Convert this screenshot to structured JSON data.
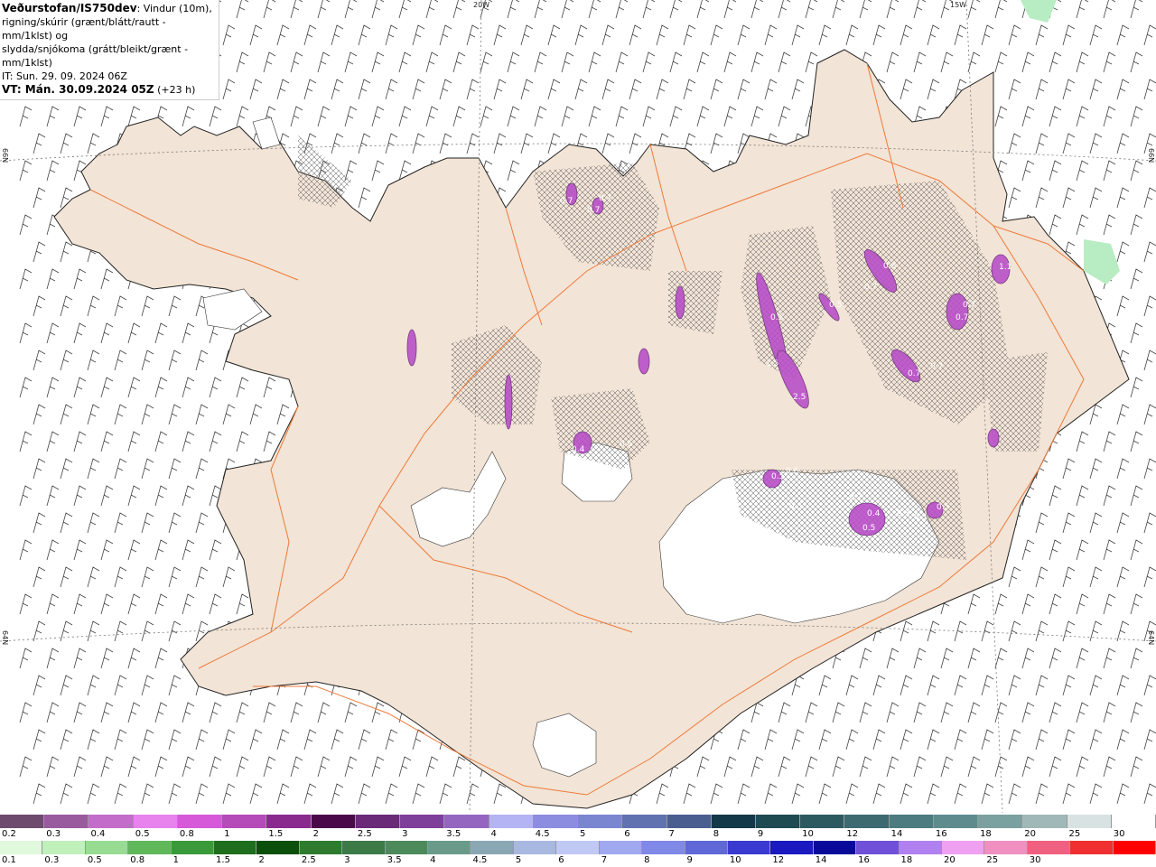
{
  "header": {
    "title": "Veðurstofan/IS750dev",
    "line1": ": Vindur (10m),",
    "line2": "rigning/skúrir (grænt/blátt/rautt - mm/1klst) og",
    "line3": "slydda/snjókoma (grátt/bleikt/grænt - mm/1klst)",
    "it_line": "IT: Sun. 29. 09. 2024 06Z",
    "vt_bold": "VT: Mán. 30.09.2024 05Z",
    "vt_rest": " (+23 h)"
  },
  "map_labels": {
    "lon_20w": "20W",
    "lon_15w": "15W",
    "lat_66_left": "66N",
    "lat_66_right": "66N",
    "lat_64_left": "64N",
    "lat_64_right": "64N"
  },
  "precip_values": [
    "0.7",
    "0.7",
    "0.7",
    "0.5",
    "0.4",
    "0.6",
    "1.5",
    "2.5",
    "0.5",
    "0.8",
    "0.7",
    "0.7",
    "0.7",
    "1.1",
    "0.7",
    "0.7",
    "0.5",
    "0.6",
    "0.7",
    "0.4",
    "0.5",
    "0.3",
    "0.3",
    "0.5",
    "0.5"
  ],
  "colors": {
    "land": "#f2e4d6",
    "ice": "#ffffff",
    "roads": "#ee7a3a",
    "coast": "#222222",
    "snow_purple": "#b84fc8",
    "rain_green": "#b8ecc2"
  },
  "scale_top": {
    "colors": [
      "#6e4a6e",
      "#9a5a9e",
      "#c36cc9",
      "#e882ec",
      "#d659d9",
      "#b44bb8",
      "#8a2a8e",
      "#4a0a4a",
      "#6a2a78",
      "#7e3f9a",
      "#9566c0",
      "#b4b4f4",
      "#8c8ce0",
      "#7a86d0",
      "#6073b0",
      "#4a5e90",
      "#133848",
      "#1e4a52",
      "#2d5a60",
      "#3c6a70",
      "#4c7c80",
      "#5e8c8e",
      "#7aa0a0",
      "#a0b8b8",
      "#d8e2e2",
      "#ffffff"
    ],
    "labels": [
      "0.2",
      "0.3",
      "0.4",
      "0.5",
      "0.8",
      "1",
      "1.5",
      "2",
      "2.5",
      "3",
      "3.5",
      "4",
      "4.5",
      "5",
      "6",
      "7",
      "8",
      "9",
      "10",
      "12",
      "14",
      "16",
      "18",
      "20",
      "25",
      "30"
    ]
  },
  "scale_bottom": {
    "colors": [
      "#e0f8dc",
      "#c0f0bc",
      "#98dc94",
      "#5fb85a",
      "#3a9a3a",
      "#1e6e1e",
      "#0a500a",
      "#2e7a2e",
      "#3c7a48",
      "#4c8a5c",
      "#6a9a8a",
      "#8aa8b4",
      "#a8b8e0",
      "#c0c8f4",
      "#a0a8f0",
      "#8088e8",
      "#6068d8",
      "#3a3ad0",
      "#1a1ac0",
      "#0a0a9a",
      "#7050d8",
      "#b080f0",
      "#f0a0f0",
      "#f090c0",
      "#f06080",
      "#f03030",
      "#ff0000"
    ],
    "labels": [
      "0.1",
      "0.3",
      "0.5",
      "0.8",
      "1",
      "1.5",
      "2",
      "2.5",
      "3",
      "3.5",
      "4",
      "4.5",
      "5",
      "6",
      "7",
      "8",
      "9",
      "10",
      "12",
      "14",
      "16",
      "18",
      "20",
      "25",
      "30"
    ]
  }
}
